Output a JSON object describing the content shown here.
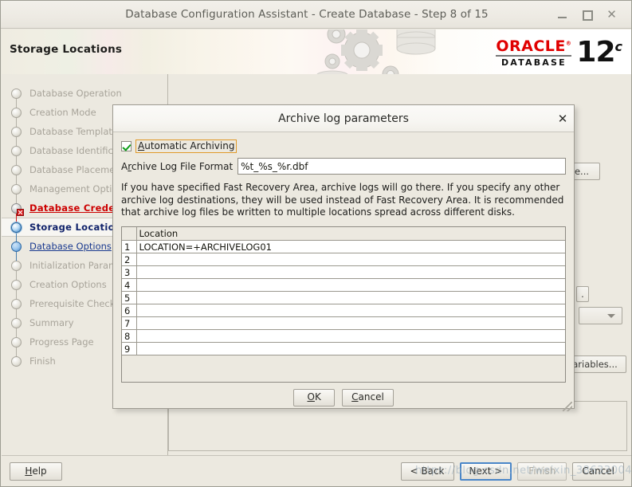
{
  "window": {
    "title": "Database Configuration Assistant - Create Database - Step 8 of 15",
    "minimize_label": "_",
    "maximize_label": "□",
    "close_label": "✕"
  },
  "banner": {
    "page_title": "Storage Locations",
    "logo_brand": "ORACLE",
    "logo_sup": "®",
    "logo_product": "DATABASE",
    "logo_version": "12",
    "logo_version_suffix": "c"
  },
  "sidebar": {
    "steps": [
      {
        "label": "Database Operation",
        "state": "disabled"
      },
      {
        "label": "Creation Mode",
        "state": "disabled"
      },
      {
        "label": "Database Template",
        "state": "disabled"
      },
      {
        "label": "Database Identification",
        "state": "disabled"
      },
      {
        "label": "Database Placement",
        "state": "disabled"
      },
      {
        "label": "Management Options",
        "state": "disabled"
      },
      {
        "label": "Database Credentials",
        "state": "error"
      },
      {
        "label": "Storage Locations",
        "state": "current"
      },
      {
        "label": "Database Options",
        "state": "done"
      },
      {
        "label": "Initialization Parameters",
        "state": "disabled"
      },
      {
        "label": "Creation Options",
        "state": "disabled"
      },
      {
        "label": "Prerequisite Checks",
        "state": "disabled"
      },
      {
        "label": "Summary",
        "state": "disabled"
      },
      {
        "label": "Progress Page",
        "state": "disabled"
      },
      {
        "label": "Finish",
        "state": "disabled"
      }
    ]
  },
  "background": {
    "browse_button_label": "e...",
    "fragment_text": "e",
    "variables_button_label": "ariables...",
    "small_button_label": "."
  },
  "dialog": {
    "title": "Archive log parameters",
    "close_label": "✕",
    "automatic_archiving": {
      "label_prefix": "A",
      "label_rest": "utomatic Archiving",
      "checked": true
    },
    "format": {
      "label_prefix": "A",
      "label_mid": "r",
      "label_rest": "chive Log File Format",
      "value": "%t_%s_%r.dbf",
      "placeholder": ""
    },
    "hint": "If you have specified Fast Recovery Area, archive logs will go there. If you specify any other archive log destinations, they will be used instead of Fast Recovery Area. It is recommended that archive log files be written to  multiple locations spread across different disks.",
    "table": {
      "column_header": "Location",
      "rows": [
        {
          "num": "1",
          "location": "LOCATION=+ARCHIVELOG01"
        },
        {
          "num": "2",
          "location": ""
        },
        {
          "num": "3",
          "location": ""
        },
        {
          "num": "4",
          "location": ""
        },
        {
          "num": "5",
          "location": ""
        },
        {
          "num": "6",
          "location": ""
        },
        {
          "num": "7",
          "location": ""
        },
        {
          "num": "8",
          "location": ""
        },
        {
          "num": "9",
          "location": ""
        }
      ]
    },
    "ok_label": "OK",
    "ok_mnemonic": "O",
    "ok_rest": "K",
    "cancel_label": "Cancel",
    "cancel_mnemonic": "C",
    "cancel_rest": "ancel"
  },
  "footer": {
    "help_label": "Help",
    "help_mnemonic": "H",
    "help_rest": "elp",
    "back_label": "< Back",
    "next_label": "Next >",
    "finish_label": "Finish",
    "cancel_label": "Cancel"
  },
  "watermark": {
    "text": "https://blog.csdn.net/weixin_38633004"
  },
  "colors": {
    "accent_blue": "#2f7cc0",
    "error_red": "#cc0000",
    "oracle_red": "#e00000",
    "focus_orange": "#e09a2a",
    "window_bg": "#ece9e0"
  }
}
